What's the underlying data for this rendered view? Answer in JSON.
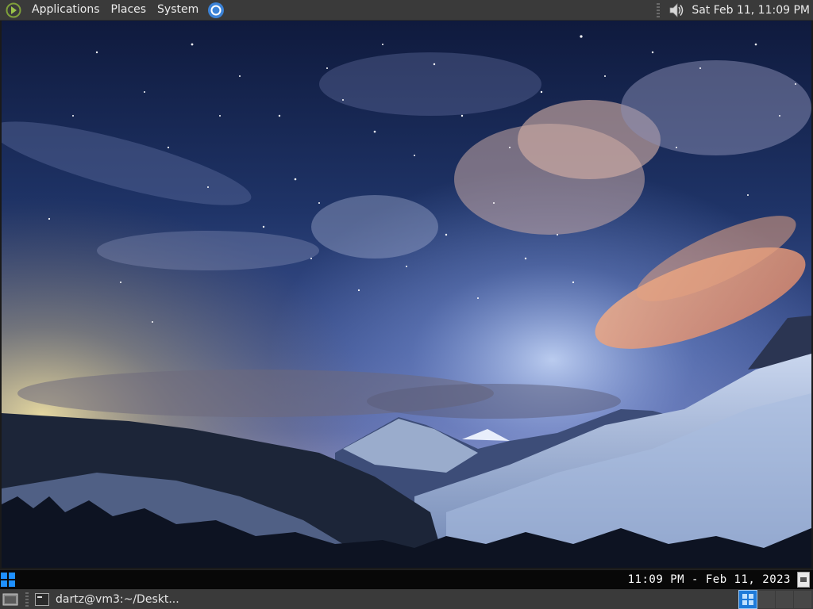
{
  "top_panel": {
    "menus": [
      "Applications",
      "Places",
      "System"
    ],
    "clock": "Sat Feb 11, 11:09 PM",
    "icons": {
      "logo": "menu-logo-icon",
      "browser": "chromium-icon",
      "volume": "volume-icon"
    }
  },
  "desktop": {
    "wallpaper": "starry night sky over snowy mountains"
  },
  "date_bar": {
    "text": "11:09 PM - Feb 11, 2023",
    "accent": "#1e90ff"
  },
  "bottom_panel": {
    "task_label": "dartz@vm3:~/Deskt...",
    "workspaces": 4,
    "active_workspace": 1
  },
  "colors": {
    "panel_bg": "#3a3a3a",
    "panel_text": "#ececec",
    "date_bar_bg": "#080808",
    "workspace_active": "#1e7ad9"
  }
}
